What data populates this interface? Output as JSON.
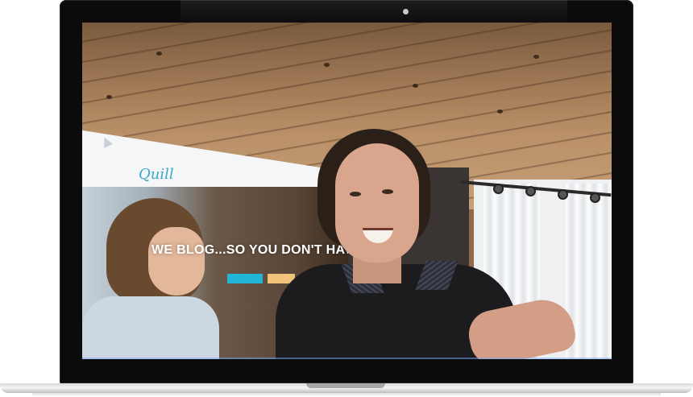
{
  "device": {
    "type": "laptop",
    "colors": {
      "bezel": "#0b0b0c",
      "base": "#e6e6e7",
      "camera": "#c9c9cb"
    }
  },
  "screen": {
    "scene": "webcam-video",
    "projected_site": {
      "logo_text": "Quill",
      "headline": "WE BLOG...SO YOU DON'T HAVE TO",
      "primary_button_label": "",
      "accent_color": "#22b6d6",
      "secondary_color": "#f1c27a"
    }
  }
}
